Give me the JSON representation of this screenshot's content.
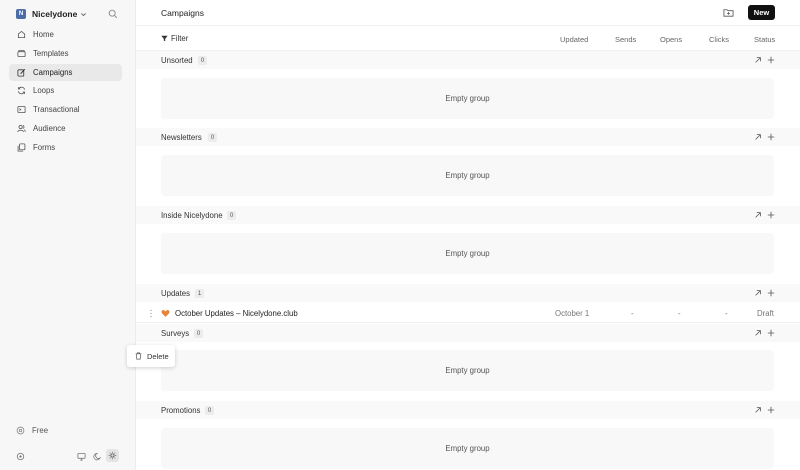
{
  "workspace": {
    "initial": "N",
    "name": "Nicelydone"
  },
  "sidebar": {
    "items": [
      {
        "label": "Home",
        "icon": "home-icon"
      },
      {
        "label": "Templates",
        "icon": "templates-icon"
      },
      {
        "label": "Campaigns",
        "icon": "campaigns-icon",
        "active": true
      },
      {
        "label": "Loops",
        "icon": "loops-icon"
      },
      {
        "label": "Transactional",
        "icon": "transactional-icon"
      },
      {
        "label": "Audience",
        "icon": "audience-icon"
      },
      {
        "label": "Forms",
        "icon": "forms-icon"
      }
    ],
    "plan_label": "Free",
    "bottom_icons": [
      "settings-icon",
      "monitor-icon",
      "moon-icon",
      "sun-icon"
    ]
  },
  "header": {
    "title": "Campaigns",
    "new_label": "New",
    "filter_label": "Filter",
    "columns": [
      "Updated",
      "Sends",
      "Opens",
      "Clicks",
      "Status"
    ]
  },
  "groups": [
    {
      "name": "Unsorted",
      "count": "0",
      "empty_label": "Empty group"
    },
    {
      "name": "Newsletters",
      "count": "0",
      "empty_label": "Empty group"
    },
    {
      "name": "Inside Nicelydone",
      "count": "0",
      "empty_label": "Empty group"
    },
    {
      "name": "Updates",
      "count": "1"
    },
    {
      "name": "Surveys",
      "count": "0",
      "empty_label": "Empty group"
    },
    {
      "name": "Promotions",
      "count": "0",
      "empty_label": "Empty group"
    }
  ],
  "campaign_row": {
    "title": "October Updates – Nicelydone.club",
    "updated": "October 1",
    "sends": "-",
    "opens": "-",
    "clicks": "-",
    "status": "Draft",
    "icon_color": "#e8833a"
  },
  "context_menu": {
    "delete_label": "Delete"
  }
}
